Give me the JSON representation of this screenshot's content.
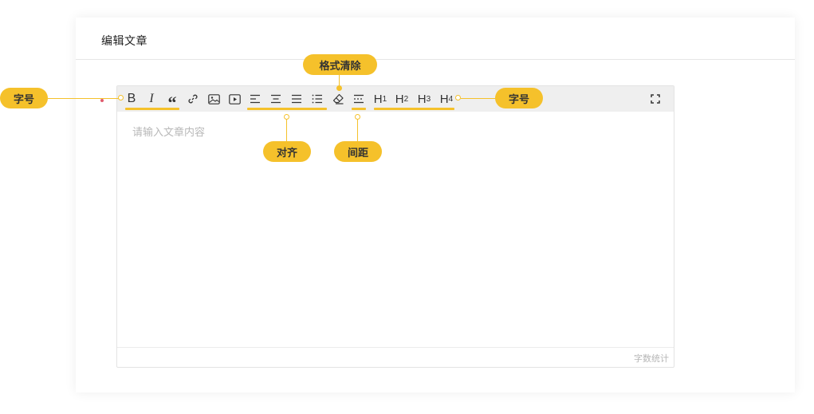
{
  "card": {
    "title": "编辑文章"
  },
  "editor": {
    "placeholder": "请输入文章内容",
    "word_count_label": "字数统计",
    "toolbar": {
      "bold": "B",
      "italic": "I",
      "quote": "“",
      "headings": [
        {
          "label": "H",
          "sub": "1"
        },
        {
          "label": "H",
          "sub": "2"
        },
        {
          "label": "H",
          "sub": "3"
        },
        {
          "label": "H",
          "sub": "4"
        }
      ]
    }
  },
  "annotations": {
    "left_font_size": "字号",
    "right_font_size": "字号",
    "format_clear": "格式清除",
    "align": "对齐",
    "spacing": "间距"
  },
  "colors": {
    "accent": "#f5c12b",
    "required": "#e05a6d",
    "toolbar_bg": "#efefef"
  },
  "icons": [
    "bold-icon",
    "italic-icon",
    "quote-icon",
    "link-icon",
    "image-icon",
    "video-icon",
    "align-left-icon",
    "align-center-icon",
    "align-justify-icon",
    "list-icon",
    "eraser-icon",
    "line-spacing-icon",
    "fullscreen-icon"
  ]
}
